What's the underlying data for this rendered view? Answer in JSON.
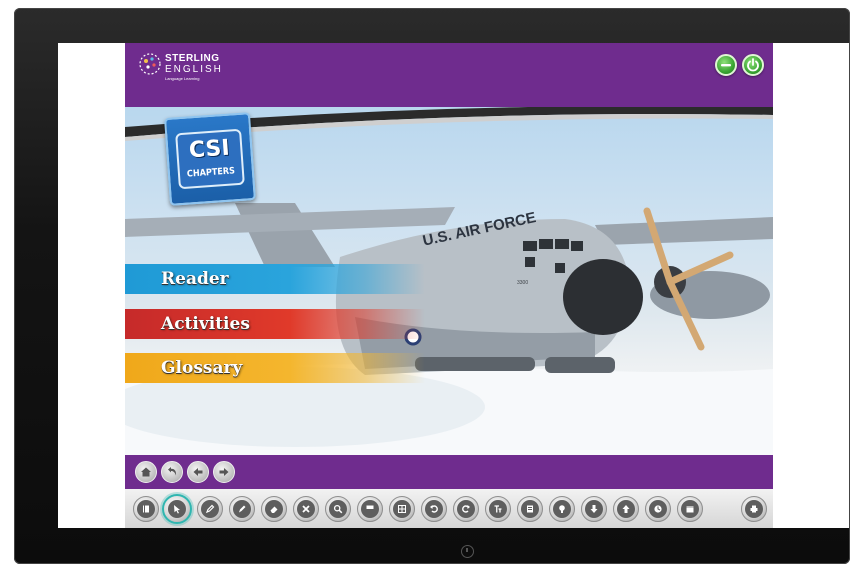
{
  "app": {
    "brand": {
      "line1": "STERLING",
      "line2": "ENGLISH",
      "line3": "Language Learning"
    },
    "badge": {
      "title": "CSI",
      "subtitle": "CHAPTERS"
    },
    "menu": [
      {
        "label": "Reader",
        "color": "#2aa4dc"
      },
      {
        "label": "Activities",
        "color": "#e03a2a"
      },
      {
        "label": "Glossary",
        "color": "#f4b62e"
      }
    ],
    "aircraft_text": "U.S. AIR FORCE",
    "aircraft_number": "3300"
  },
  "top_controls": [
    {
      "name": "minimize-icon"
    },
    {
      "name": "power-icon"
    }
  ],
  "nav_buttons": [
    {
      "name": "home-icon"
    },
    {
      "name": "back-icon"
    },
    {
      "name": "previous-arrow-icon"
    },
    {
      "name": "next-arrow-icon"
    }
  ],
  "toolbar": [
    {
      "name": "book-icon"
    },
    {
      "name": "pointer-icon",
      "active": true
    },
    {
      "name": "pencil-icon"
    },
    {
      "name": "marker-icon"
    },
    {
      "name": "eraser-icon"
    },
    {
      "name": "clear-icon"
    },
    {
      "name": "zoom-icon"
    },
    {
      "name": "mask-icon"
    },
    {
      "name": "grid-icon"
    },
    {
      "name": "undo-icon"
    },
    {
      "name": "redo-icon"
    },
    {
      "name": "text-tool-icon"
    },
    {
      "name": "notes-icon"
    },
    {
      "name": "spotlight-icon"
    },
    {
      "name": "download-icon"
    },
    {
      "name": "upload-icon"
    },
    {
      "name": "clock-icon"
    },
    {
      "name": "calendar-icon"
    },
    {
      "name": "print-icon"
    }
  ],
  "colors": {
    "brand_purple": "#6f2c8e",
    "active_ring": "#2fb6b0",
    "power_green": "#3aa533"
  }
}
